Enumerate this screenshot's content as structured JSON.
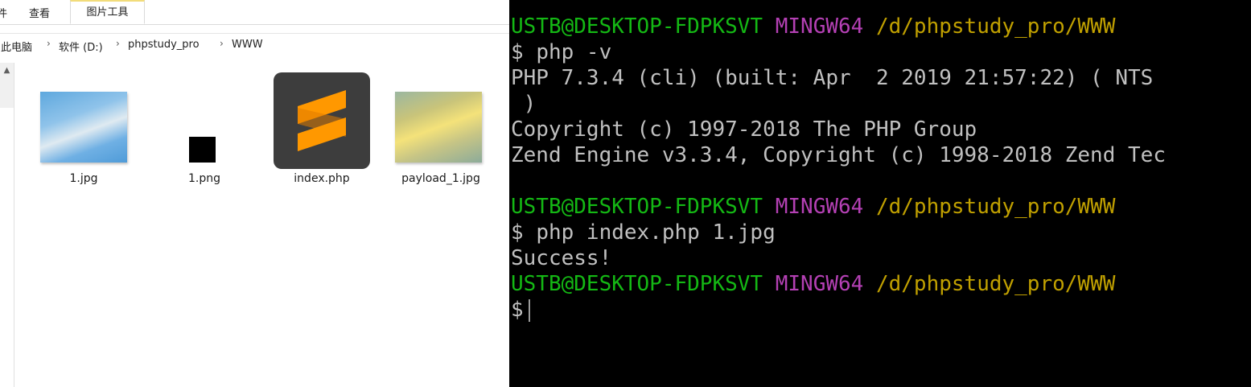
{
  "explorer": {
    "tabs": {
      "first": "件",
      "view": "查看",
      "tools": "图片工具"
    },
    "breadcrumb": [
      "此电脑",
      "软件 (D:)",
      "phpstudy_pro",
      "WWW"
    ],
    "breadcrumb_sep": "›",
    "files": [
      {
        "name": "1.jpg"
      },
      {
        "name": "1.png"
      },
      {
        "name": "index.php"
      },
      {
        "name": "payload_1.jpg"
      }
    ]
  },
  "terminal": {
    "prompt": {
      "user": "USTB@DESKTOP-FDPKSVT",
      "env": "MINGW64",
      "path": "/d/phpstudy_pro/WWW"
    },
    "dollar": "$",
    "cmd1": "php -v",
    "out1": "PHP 7.3.4 (cli) (built: Apr  2 2019 21:57:22) ( NTS",
    "out1b": " )",
    "out2": "Copyright (c) 1997-2018 The PHP Group",
    "out3": "Zend Engine v3.3.4, Copyright (c) 1998-2018 Zend Tec",
    "cmd2": "php index.php 1.jpg",
    "out4": "Success!"
  },
  "colors": {
    "user": "#14b814",
    "env": "#b440b4",
    "path": "#c0a000",
    "terminal_bg": "#000000",
    "sublime_orange": "#ff9800"
  }
}
